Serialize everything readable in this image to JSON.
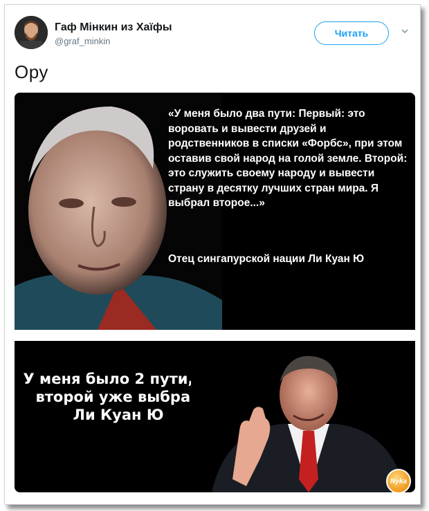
{
  "tweet": {
    "display_name": "Гаф Мінкин из Хаїфы",
    "handle": "@graf_minkin",
    "follow_label": "Читать",
    "text": "Ору"
  },
  "meme": {
    "top_quote": "«У меня было два пути: Первый: это воровать и вывести друзей и родственников в списки «Форбс», при этом оставив свой народ на голой земле. Второй: это служить своему народу и вывести страну в десятку лучших стран мира. Я выбрал второе...»",
    "top_attribution": "Отец сингапурской нации Ли Куан Ю",
    "bottom_caption": "У меня было 2 пути,но\nвторой уже выбрал\nЛи Куан Ю",
    "watermark": "Nyka"
  }
}
